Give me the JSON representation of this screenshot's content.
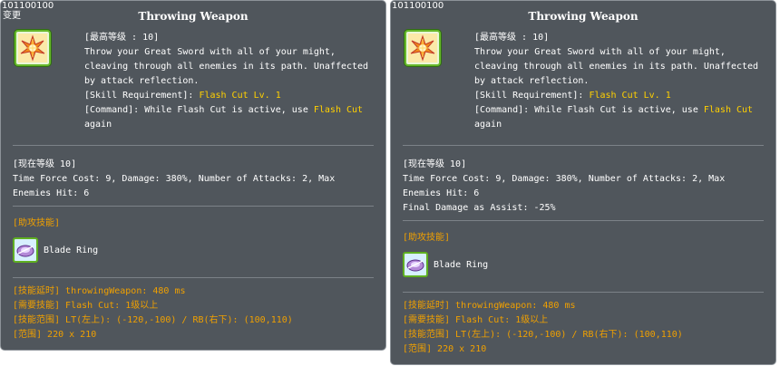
{
  "tooltips": [
    {
      "id_label": "101100100",
      "sub_label": "变更",
      "title": "Throwing Weapon",
      "max_level": "[最高等级 : 10]",
      "desc_lines": [
        "Throw your Great Sword with all of your might,",
        "cleaving through all enemies in its path. Unaffected",
        "by attack reflection."
      ],
      "req_prefix": "[Skill Requirement]: ",
      "req_value": "Flash Cut Lv. 1",
      "cmd_prefix": "[Command]: While Flash Cut is active, use ",
      "cmd_value": "Flash Cut",
      "cmd_suffix": "again",
      "current_level": "[现在等级 10]",
      "stats_lines": [
        "Time Force Cost: 9, Damage: 380%, Number of Attacks: 2, Max",
        "Enemies Hit: 6"
      ],
      "assist_header": "[助攻技能]",
      "assist_skill": "Blade Ring",
      "extra_lines": [
        "[技能延时] throwingWeapon: 480 ms",
        "[需要技能] Flash Cut: 1级以上",
        "[技能范围] LT(左上): (-120,-100) / RB(右下): (100,110)",
        "[范围] 220 x 210"
      ]
    },
    {
      "id_label": "101100100",
      "title": "Throwing Weapon",
      "max_level": "[最高等级 : 10]",
      "desc_lines": [
        "Throw your Great Sword with all of your might,",
        "cleaving through all enemies in its path. Unaffected",
        "by attack reflection."
      ],
      "req_prefix": "[Skill Requirement]: ",
      "req_value": "Flash Cut Lv. 1",
      "cmd_prefix": "[Command]: While Flash Cut is active, use ",
      "cmd_value": "Flash Cut",
      "cmd_suffix": "again",
      "current_level": "[现在等级 10]",
      "stats_lines": [
        "Time Force Cost: 9, Damage: 380%, Number of Attacks: 2, Max",
        "Enemies Hit: 6",
        "Final Damage as Assist: -25%"
      ],
      "assist_header": "[助攻技能]",
      "assist_skill": "Blade Ring",
      "extra_lines": [
        "[技能延时] throwingWeapon: 480 ms",
        "[需要技能] Flash Cut: 1级以上",
        "[技能范围] LT(左上): (-120,-100) / RB(右下): (100,110)",
        "[范围] 220 x 210"
      ]
    }
  ],
  "colors": {
    "panel_bg": "#50565c",
    "highlight_yellow": "#ffd000",
    "label_orange": "#f0a000"
  },
  "icons": {
    "skill_icon": "throwing-weapon-icon",
    "assist_icon": "blade-ring-icon"
  }
}
